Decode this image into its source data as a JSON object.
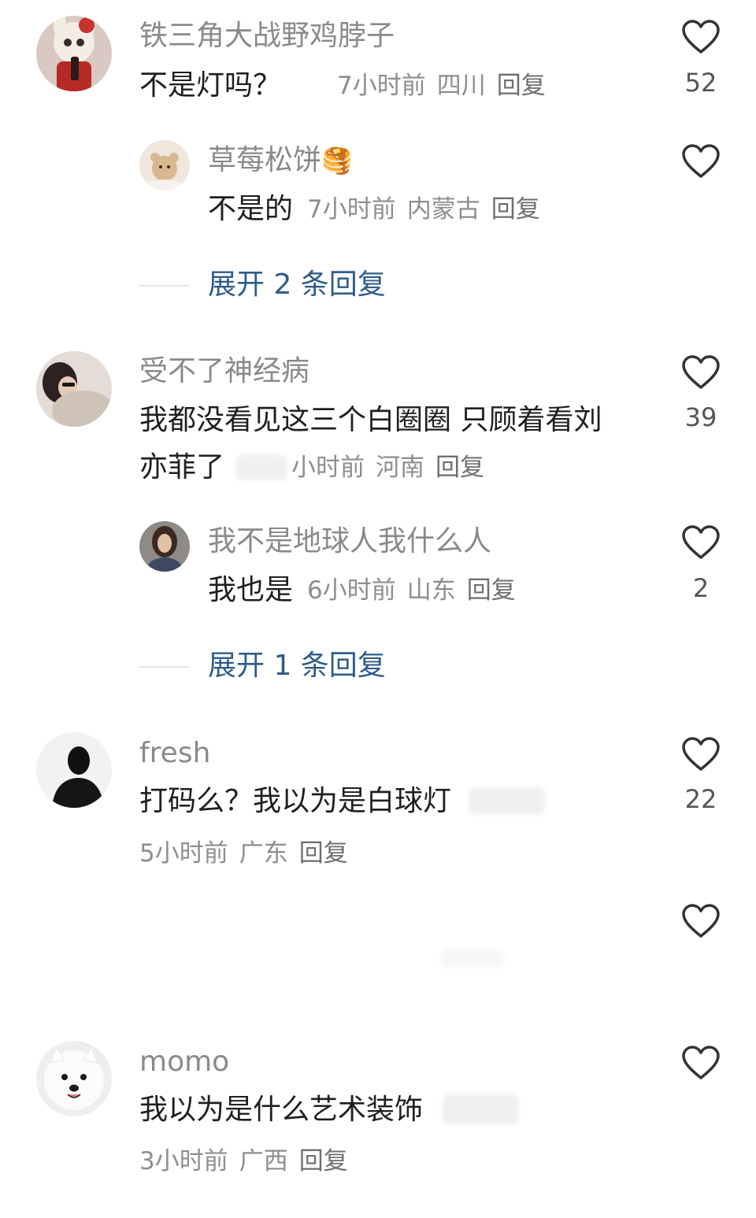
{
  "comments": [
    {
      "username": "铁三角大战野鸡脖子",
      "text": "不是灯吗？",
      "time": "7小时前",
      "location": "四川",
      "reply_label": "回复",
      "likes": "52",
      "avatar_icon": "plush-toy-avatar",
      "replies": [
        {
          "username": "草莓松饼",
          "username_emoji": "🥞",
          "text": "不是的",
          "time": "7小时前",
          "location": "内蒙古",
          "reply_label": "回复",
          "likes": "",
          "avatar_icon": "teddy-bear-avatar"
        }
      ],
      "expand_label": "展开 2 条回复"
    },
    {
      "username": "受不了神经病",
      "text_line1": "我都没看见这三个白圈圈 只顾着看刘",
      "text_line2": "亦菲了",
      "time": "小时前",
      "location": "河南",
      "reply_label": "回复",
      "likes": "39",
      "avatar_icon": "woman-lying-avatar",
      "replies": [
        {
          "username": "我不是地球人我什么人",
          "text": "我也是",
          "time": "6小时前",
          "location": "山东",
          "reply_label": "回复",
          "likes": "2",
          "avatar_icon": "girl-portrait-avatar"
        }
      ],
      "expand_label": "展开 1 条回复"
    },
    {
      "username": "fresh",
      "text": "打码么？我以为是白球灯",
      "time": "5小时前",
      "location": "广东",
      "reply_label": "回复",
      "likes": "22",
      "avatar_icon": "silhouette-avatar"
    },
    {
      "username": "",
      "text": "",
      "likes": ""
    },
    {
      "username": "momo",
      "text": "我以为是什么艺术装饰",
      "time": "3小时前",
      "location": "广西",
      "reply_label": "回复",
      "likes": "",
      "avatar_icon": "samoyed-dog-avatar"
    }
  ],
  "colors": {
    "username": "#8a8a8a",
    "text": "#1f1f1f",
    "meta": "#8e8e8e",
    "expand": "#2f5d8a",
    "heart_stroke": "#333333"
  }
}
